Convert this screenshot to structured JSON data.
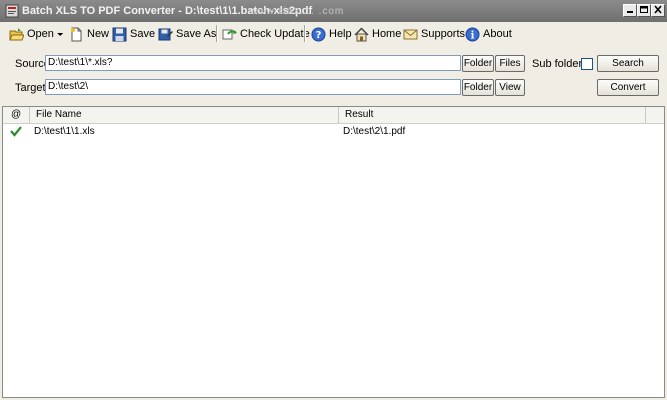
{
  "window": {
    "title": "Batch XLS TO PDF Converter - D:\\test\\1\\1.batch-xls2pdf",
    "watermark": "www.xiaz.... .com"
  },
  "toolbar": {
    "open": "Open",
    "new": "New",
    "save": "Save",
    "save_as": "Save As",
    "check_update": "Check Update",
    "help": "Help",
    "home": "Home",
    "supports": "Supports",
    "about": "About"
  },
  "form": {
    "source_label": "Source",
    "source_value": "D:\\test\\1\\*.xls?",
    "target_label": "Target",
    "target_value": "D:\\test\\2\\",
    "folder_label": "Folder",
    "files_label": "Files",
    "view_label": "View",
    "subfolders_label": "Sub folders",
    "search_label": "Search",
    "convert_label": "Convert"
  },
  "list": {
    "columns": [
      "@",
      "File Name",
      "Result"
    ],
    "rows": [
      {
        "status": "success",
        "file": "D:\\test\\1\\1.xls",
        "result": "D:\\test\\2\\1.pdf"
      }
    ]
  },
  "colors": {
    "titlebar": "#7a7a7a",
    "success": "#2e8b2e"
  }
}
